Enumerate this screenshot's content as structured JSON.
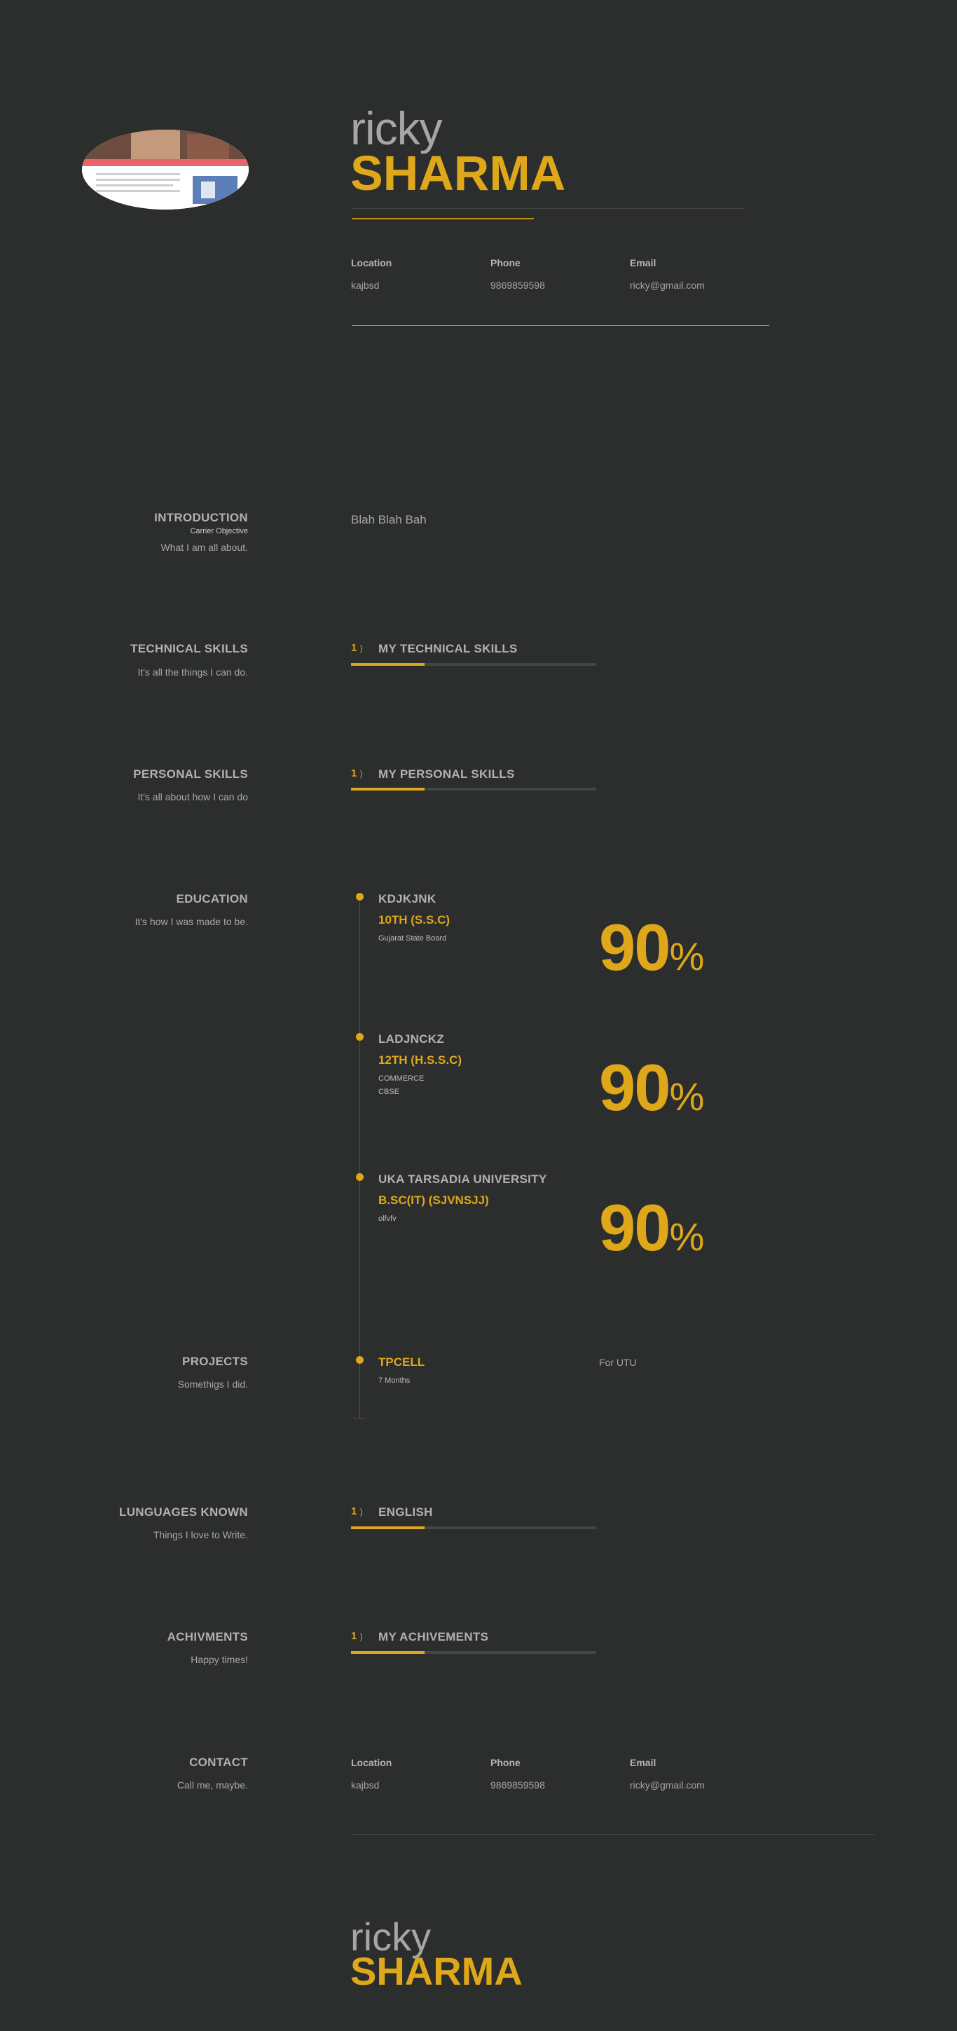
{
  "header": {
    "first_name": "ricky",
    "last_name": "SHARMA",
    "avatar_alt": "About Us",
    "info": [
      {
        "label": "Location",
        "value": "kajbsd"
      },
      {
        "label": "Phone",
        "value": "9869859598"
      },
      {
        "label": "Email",
        "value": "ricky@gmail.com"
      }
    ]
  },
  "introduction": {
    "title": "INTRODUCTION",
    "small": "Carrier Objective",
    "subtitle": "What I am all about.",
    "text": "Blah Blah Bah"
  },
  "technical_skills": {
    "title": "TECHNICAL SKILLS",
    "subtitle": "It's all the things I can do.",
    "items": [
      {
        "num": "1",
        "paren": ")",
        "name": "MY TECHNICAL SKILLS",
        "level": 0.3
      }
    ]
  },
  "personal_skills": {
    "title": "PERSONAL SKILLS",
    "subtitle": "It's all about how I can do",
    "items": [
      {
        "num": "1",
        "paren": ")",
        "name": "MY PERSONAL SKILLS",
        "level": 0.3
      }
    ]
  },
  "education": {
    "title": "EDUCATION",
    "subtitle": "It's how I was made to be.",
    "entries": [
      {
        "school": "KDJKJNK",
        "degree": "10TH (S.S.C)",
        "details": [
          "Gujarat State Board"
        ],
        "score": "90",
        "unit": "%"
      },
      {
        "school": "LADJNCKZ",
        "degree": "12TH (H.S.S.C)",
        "details": [
          "COMMERCE",
          "CBSE"
        ],
        "score": "90",
        "unit": "%"
      },
      {
        "school": "UKA TARSADIA UNIVERSITY",
        "degree": "B.SC(IT) (SJVNSJJ)",
        "details": [
          "olfvfv"
        ],
        "score": "90",
        "unit": "%"
      }
    ]
  },
  "projects": {
    "title": "PROJECTS",
    "subtitle": "Somethigs I did.",
    "items": [
      {
        "name": "TPCELL",
        "detail": "7 Months",
        "desc": "For UTU"
      }
    ]
  },
  "languages": {
    "title": "LUNGUAGES KNOWN",
    "subtitle": "Things I love to Write.",
    "items": [
      {
        "num": "1",
        "paren": ")",
        "name": "ENGLISH",
        "level": 0.3
      }
    ]
  },
  "achievements": {
    "title": "ACHIVMENTS",
    "subtitle": "Happy times!",
    "items": [
      {
        "num": "1",
        "paren": ")",
        "name": "MY ACHIVEMENTS",
        "level": 0.3
      }
    ]
  },
  "contact": {
    "title": "CONTACT",
    "subtitle": "Call me, maybe.",
    "info": [
      {
        "label": "Location",
        "value": "kajbsd"
      },
      {
        "label": "Phone",
        "value": "9869859598"
      },
      {
        "label": "Email",
        "value": "ricky@gmail.com"
      }
    ]
  },
  "footer": {
    "first_name": "ricky",
    "last_name": "SHARMA"
  },
  "colors": {
    "background": "#2c2d2d",
    "accent": "#dea81a",
    "text": "#a9a9a9"
  }
}
